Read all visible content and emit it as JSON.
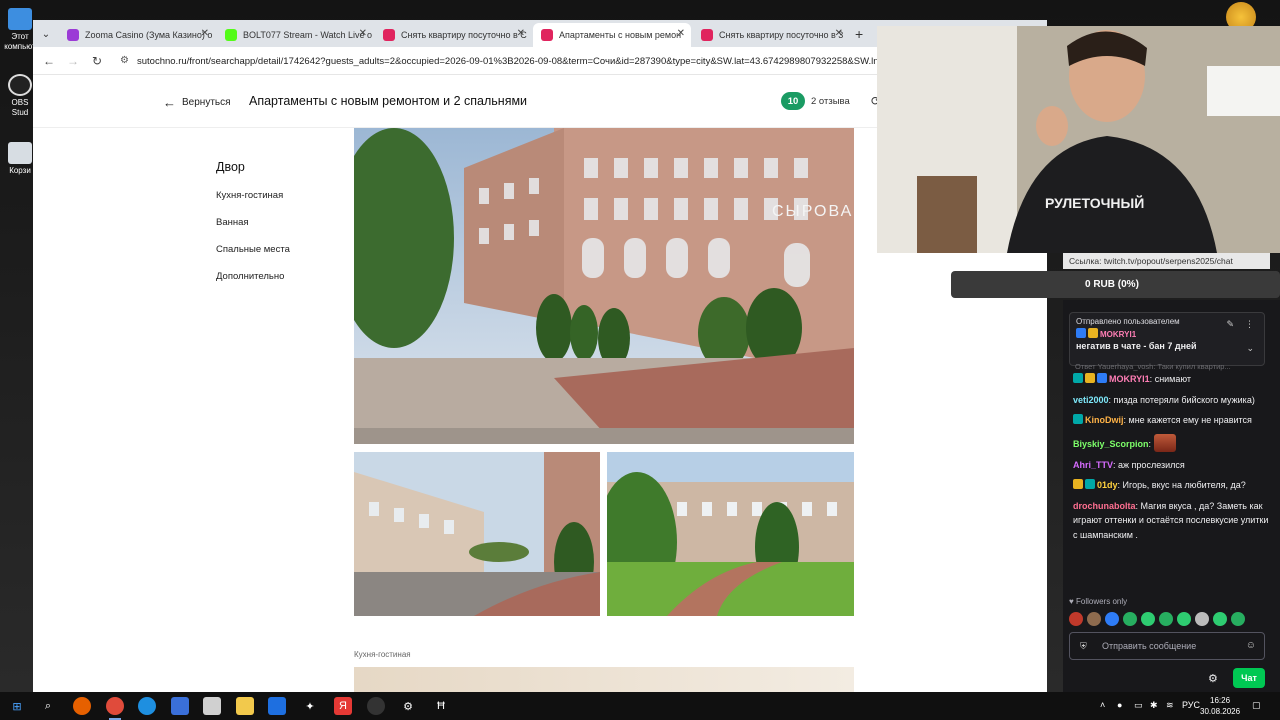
{
  "desktop": {
    "icons": [
      {
        "label": "Этот компьют"
      },
      {
        "label": "OBS Stud"
      },
      {
        "label": "Корзи"
      }
    ]
  },
  "browser": {
    "tabs": [
      {
        "title": "Zooma Casino (Зума Казино) о",
        "active": false,
        "color": "#9b3bd6"
      },
      {
        "title": "BOLT077 Stream - Watch Live o",
        "active": false,
        "color": "#53fc18"
      },
      {
        "title": "Снять квартиру посуточно в С",
        "active": false,
        "color": "#e0245e"
      },
      {
        "title": "Апартаменты с новым ремон",
        "active": true,
        "color": "#e0245e"
      },
      {
        "title": "Снять квартиру посуточно в 3",
        "active": false,
        "color": "#e0245e"
      }
    ],
    "url": "sutochno.ru/front/searchapp/detail/1742642?guests_adults=2&occupied=2026-09-01%3B2026-09-08&term=Сочи&id=287390&type=city&SW.lat=43.6742989807932258&SW.lng="
  },
  "page": {
    "back_label": "Вернуться",
    "title": "Апартаменты с новым ремонтом и 2 спальнями",
    "rating": "10",
    "reviews": "2 отзыва",
    "nav_heading": "Двор",
    "nav_items": [
      "Кухня-гостиная",
      "Ванная",
      "Спальные места",
      "Дополнительно"
    ],
    "section_label": "Кухня-гостиная",
    "building_sign": "СЫРОВА"
  },
  "stream": {
    "cam_url": "Ссылка: twitch.tv/popout/serpens2025/chat",
    "shirt_text": "РУЛЕТОЧНЫЙ",
    "balance": "0 RUB (0%)"
  },
  "chat": {
    "pinned_by": "Отправлено пользователем",
    "pinned_user": "MOKRYI1",
    "pinned_text": "негатив в чате - бан 7 дней",
    "reply_hint": "Ответ Yauerhaya_vosh: Таки купил квартир...",
    "messages": [
      {
        "user": "MOKRYI1",
        "text": "снимают",
        "color": "#ff7eb6"
      },
      {
        "user": "veti2000",
        "text": "пизда потеряли бийского мужика)",
        "color": "#7ee8fa"
      },
      {
        "user": "KinoDwij",
        "text": "мне кажется ему не нравится",
        "color": "#ffb347"
      },
      {
        "user": "Biyskiy_Scorpion",
        "text": "",
        "color": "#7dff6a"
      },
      {
        "user": "Ahri_TTV",
        "text": "аж прослезился",
        "color": "#d66bff"
      },
      {
        "user": "01dy",
        "text": "Игорь, вкус на любителя, да?",
        "color": "#ffd23f"
      },
      {
        "user": "drochunabolta",
        "text": "Магия вкуса , да? Заметь как играют оттенки и остаётся послевкусие улитки с шампанским .",
        "color": "#ff6f91"
      }
    ],
    "followers_label": "Followers only",
    "input_placeholder": "Отправить сообщение",
    "chat_button": "Чат"
  },
  "taskbar": {
    "lang": "РУС",
    "time": "16:26",
    "date": "30.08.2026"
  }
}
